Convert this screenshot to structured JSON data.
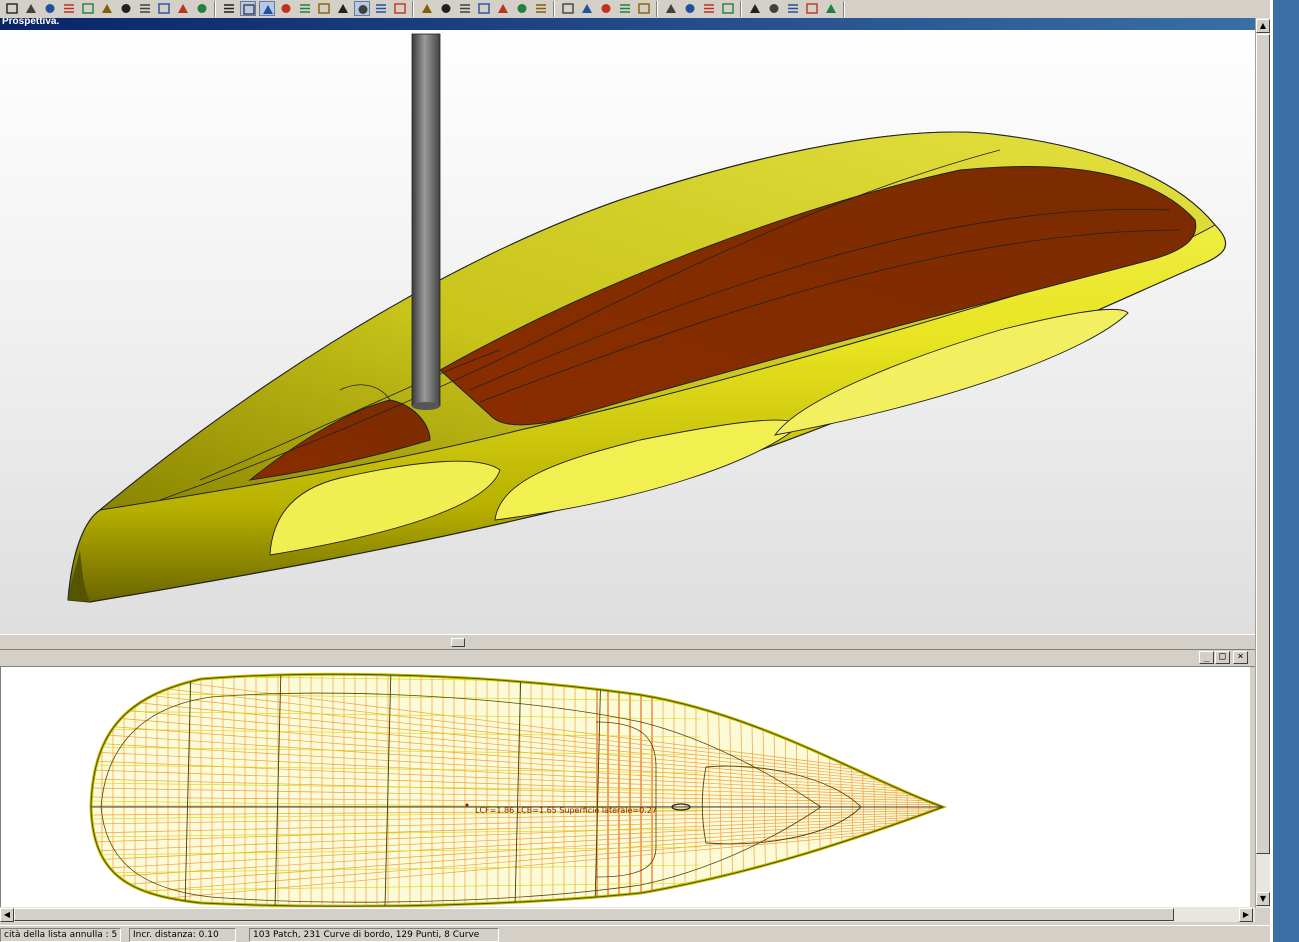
{
  "viewport_top": {
    "title": "Prospettiva."
  },
  "viewport_bottom": {
    "hydro_label": "LCF=1.86 LCB=1.65 Superficie laterale=0.27",
    "window_controls": {
      "minimize": "_",
      "maximize": "□",
      "close": "×"
    }
  },
  "statusbar": {
    "undo_capacity": "cità della lista annulla : 5",
    "distance_increment": "Incr. distanza: 0.10",
    "model_summary": "103 Patch, 231 Curve di bordo, 129 Punti, 8 Curve"
  },
  "toolbar": {
    "icons": [
      "point-icon",
      "move-icon",
      "rotate-icon",
      "hand-icon",
      "arrow-icon",
      "flag-icon",
      "move-point-icon",
      "lock-icon",
      "link-icon",
      "node-icon",
      "transform-icon",
      "grid-icon",
      "curve-icon",
      "mesh-icon",
      "shaded-icon",
      "wire-icon",
      "sphere-icon",
      "layers-icon",
      "lines-icon",
      "stack-icon",
      "table-icon",
      "zoom-icon",
      "cursor-icon",
      "pen-icon",
      "edit-icon",
      "bezier-icon",
      "spiral-icon",
      "plug-icon",
      "view-front-icon",
      "view-side-icon",
      "view-top-icon",
      "view-persp-icon",
      "undo-icon",
      "redo-icon",
      "phone-icon",
      "cut-icon",
      "paste-icon",
      "print-icon",
      "calc-icon",
      "close-file-icon",
      "shield-blue-icon",
      "shield-dark-icon"
    ]
  }
}
